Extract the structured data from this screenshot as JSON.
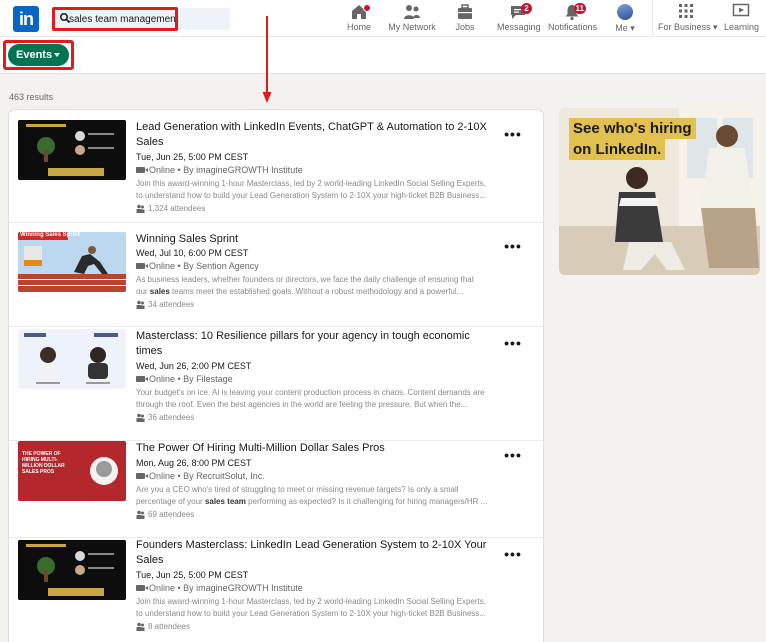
{
  "nav": {
    "search_value": "sales team management",
    "items": [
      {
        "label": "Home",
        "icon": "home-icon"
      },
      {
        "label": "My Network",
        "icon": "network-icon"
      },
      {
        "label": "Jobs",
        "icon": "briefcase-icon"
      },
      {
        "label": "Messaging",
        "icon": "messaging-icon",
        "badge": "2"
      },
      {
        "label": "Notifications",
        "icon": "bell-icon",
        "badge": "11"
      },
      {
        "label": "Me",
        "icon": "avatar"
      },
      {
        "label": "For Business",
        "icon": "grid-icon"
      },
      {
        "label": "Learning",
        "icon": "learning-icon"
      }
    ]
  },
  "filter": {
    "events_label": "Events"
  },
  "results": {
    "count_label": "463 results",
    "items": [
      {
        "title": "Lead Generation with LinkedIn Events, ChatGPT & Automation to 2-10X Sales",
        "date": "Tue, Jun 25, 5:00 PM CEST",
        "meta": "Online • By imagineGROWTH Institute",
        "desc_1": "Join this award-winning 1-hour Masterclass, led by 2 world-leading LinkedIn Social Selling Experts,",
        "desc_2": "to understand how to build your Lead Generation System to 2-10X your high-ticket B2B Business...",
        "attendees": "1,324 attendees"
      },
      {
        "title": "Winning Sales Sprint",
        "date": "Wed, Jul 10, 6:00 PM CEST",
        "meta": "Online • By Sention Agency",
        "desc_1": "As business leaders, whether founders or directors, we face the daily challenge of ensuring that",
        "desc_2_pre": "our ",
        "desc_2_bold": "sales",
        "desc_2_post": " teams meet the established goals. Without a robust methodology and a powerful...",
        "attendees": "34 attendees",
        "thumb_text": "Winning Sales Sprint"
      },
      {
        "title": "Masterclass: 10 Resilience pillars for your agency in tough economic times",
        "date": "Wed, Jun 26, 2:00 PM CEST",
        "meta": "Online • By Filestage",
        "desc_1": "Your budget's on ice. AI is leaving your content production process in chaos. Content demands are",
        "desc_2": "through the roof. Even the best agencies in the world are feeling the pressure. But when the...",
        "attendees": "36 attendees"
      },
      {
        "title": "The Power Of Hiring Multi-Million Dollar Sales Pros",
        "date": "Mon, Aug 26, 8:00 PM CEST",
        "meta": "Online • By RecruitSolut, Inc.",
        "desc_1": "Are you a CEO who's tired of struggling to meet or missing revenue targets? Is only a small",
        "desc_2_pre": "percentage of your ",
        "desc_2_bold": "sales team",
        "desc_2_post": " performing as expected? Is it challenging for hiring managers/HR ...",
        "attendees": "69 attendees",
        "thumb_text": "THE POWER OF HIRING MULTI-MILLION DOLLAR SALES PROS"
      },
      {
        "title": "Founders Masterclass: LinkedIn Lead Generation System to 2-10X Your Sales",
        "date": "Tue, Jun 25, 5:00 PM CEST",
        "meta": "Online • By imagineGROWTH Institute",
        "desc_1": "Join this award-winning 1-hour Masterclass, led by 2 world-leading LinkedIn Social Selling Experts,",
        "desc_2": "to understand how to build your Lead Generation System to 2-10X your high-ticket B2B Business...",
        "attendees": "8 attendees"
      }
    ]
  },
  "ad": {
    "line_1": "See who's hiring",
    "line_2": "on LinkedIn."
  },
  "colors": {
    "brand": "#0a66c2",
    "events_pill": "#01754f",
    "highlight": "#e01b1b",
    "badge": "#cb112d",
    "ad_accent": "#e3c14f"
  }
}
